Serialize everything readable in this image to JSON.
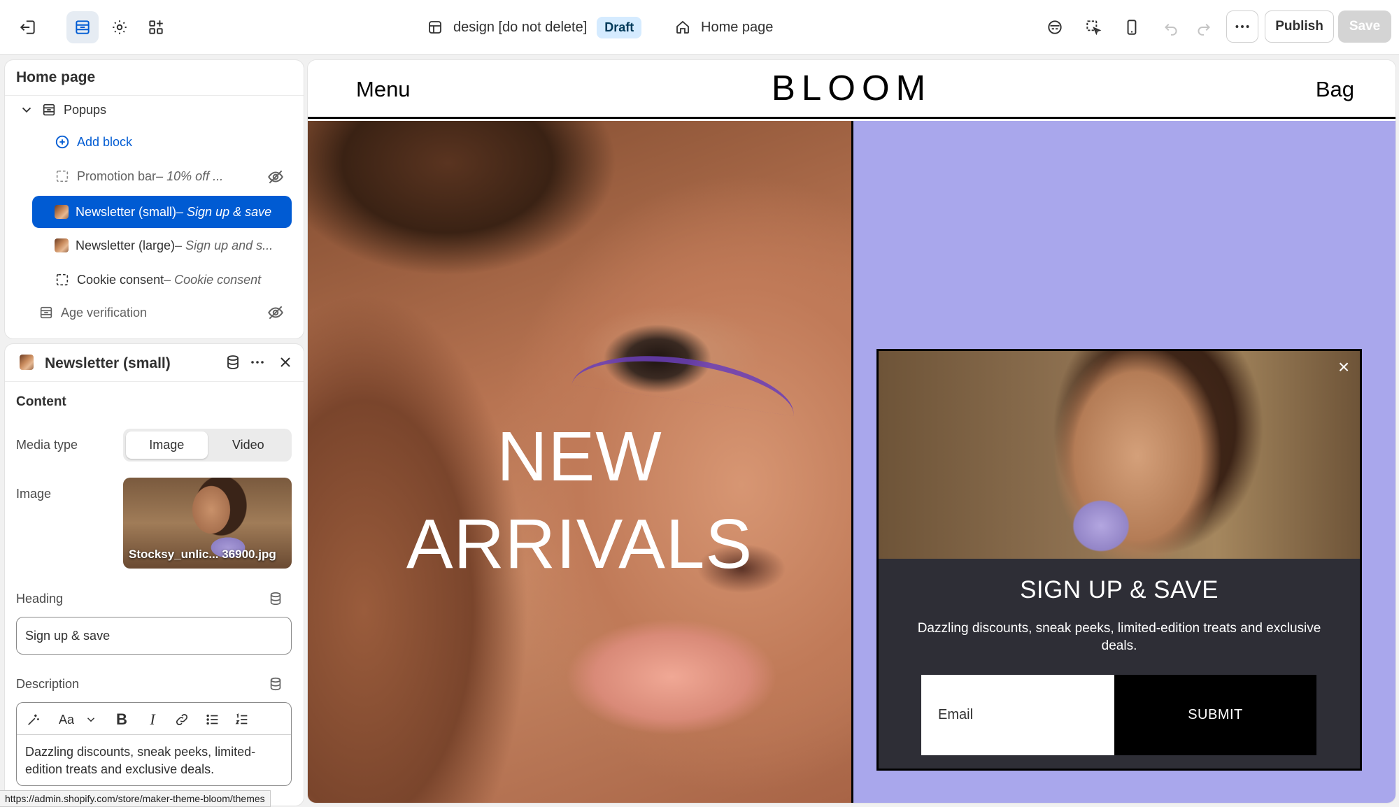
{
  "topbar": {
    "theme_name": "design [do not delete]",
    "theme_status": "Draft",
    "page_name": "Home page",
    "publish_label": "Publish",
    "save_label": "Save",
    "icons": [
      "exit-icon",
      "sections-icon",
      "settings-icon",
      "apps-icon",
      "layout-icon",
      "home-icon",
      "preview-inspector-icon",
      "inspect-icon",
      "mobile-icon",
      "undo-icon",
      "redo-icon",
      "more-icon"
    ]
  },
  "sidebar": {
    "title": "Home page",
    "items": [
      {
        "label": "Popups",
        "sub": ""
      },
      {
        "label": "Add block",
        "sub": ""
      },
      {
        "label": "Promotion bar",
        "sub": " – 10% off ..."
      },
      {
        "label": "Newsletter (small)",
        "sub": " – Sign up & save"
      },
      {
        "label": "Newsletter (large)",
        "sub": " – Sign up and s..."
      },
      {
        "label": "Cookie consent",
        "sub": " – Cookie consent"
      },
      {
        "label": "Age verification",
        "sub": ""
      }
    ]
  },
  "settings": {
    "title": "Newsletter (small)",
    "section": "Content",
    "media_type_label": "Media type",
    "media_options": [
      "Image",
      "Video"
    ],
    "media_selected": "Image",
    "image_label": "Image",
    "image_filename": "Stocksy_unlic... 36900.jpg",
    "heading_label": "Heading",
    "heading_value": "Sign up & save",
    "description_label": "Description",
    "description_value": "Dazzling discounts, sneak peeks, limited-edition treats and exclusive deals."
  },
  "statusbar": {
    "url": "https://admin.shopify.com/store/maker-theme-bloom/themes"
  },
  "preview": {
    "menu": "Menu",
    "logo": "BLOOM",
    "bag": "Bag",
    "hero_line1": "NEW",
    "hero_line2": "ARRIVALS",
    "popup": {
      "close": "×",
      "title": "SIGN UP & SAVE",
      "description": "Dazzling discounts, sneak peeks, limited-edition treats and exclusive deals.",
      "email_placeholder": "Email",
      "submit": "SUBMIT"
    },
    "colors": {
      "right_panel": "#a9a7ec",
      "popup_bg": "#2e2e36",
      "accent": "#005bd3"
    }
  }
}
